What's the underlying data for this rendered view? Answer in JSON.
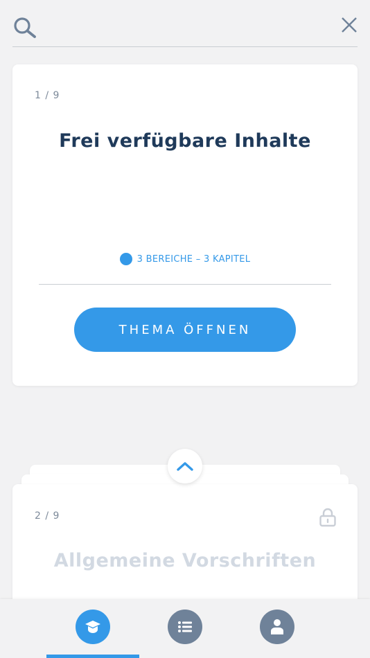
{
  "search": {
    "placeholder": "",
    "icon": "search-icon",
    "close_icon": "close-icon"
  },
  "current_card": {
    "counter": "1 / 9",
    "title": "Frei verfügbare Inhalte",
    "meta": "3 BEREICHE – 3 KAPITEL",
    "button_label": "THEMA ÖFFNEN"
  },
  "next_card": {
    "counter": "2 / 9",
    "title": "Allgemeine Vorschriften",
    "locked": true
  },
  "nav": {
    "items": [
      {
        "name": "learn",
        "icon": "graduation-cap-icon",
        "active": true
      },
      {
        "name": "list",
        "icon": "list-icon",
        "active": false
      },
      {
        "name": "profile",
        "icon": "user-icon",
        "active": false
      }
    ]
  },
  "colors": {
    "accent": "#3499e8",
    "title": "#1f3a5a",
    "muted": "#7d8a9a",
    "inactive_nav": "#6f8299",
    "locked_title": "#d2d9e2",
    "background": "#f2f2f3"
  }
}
